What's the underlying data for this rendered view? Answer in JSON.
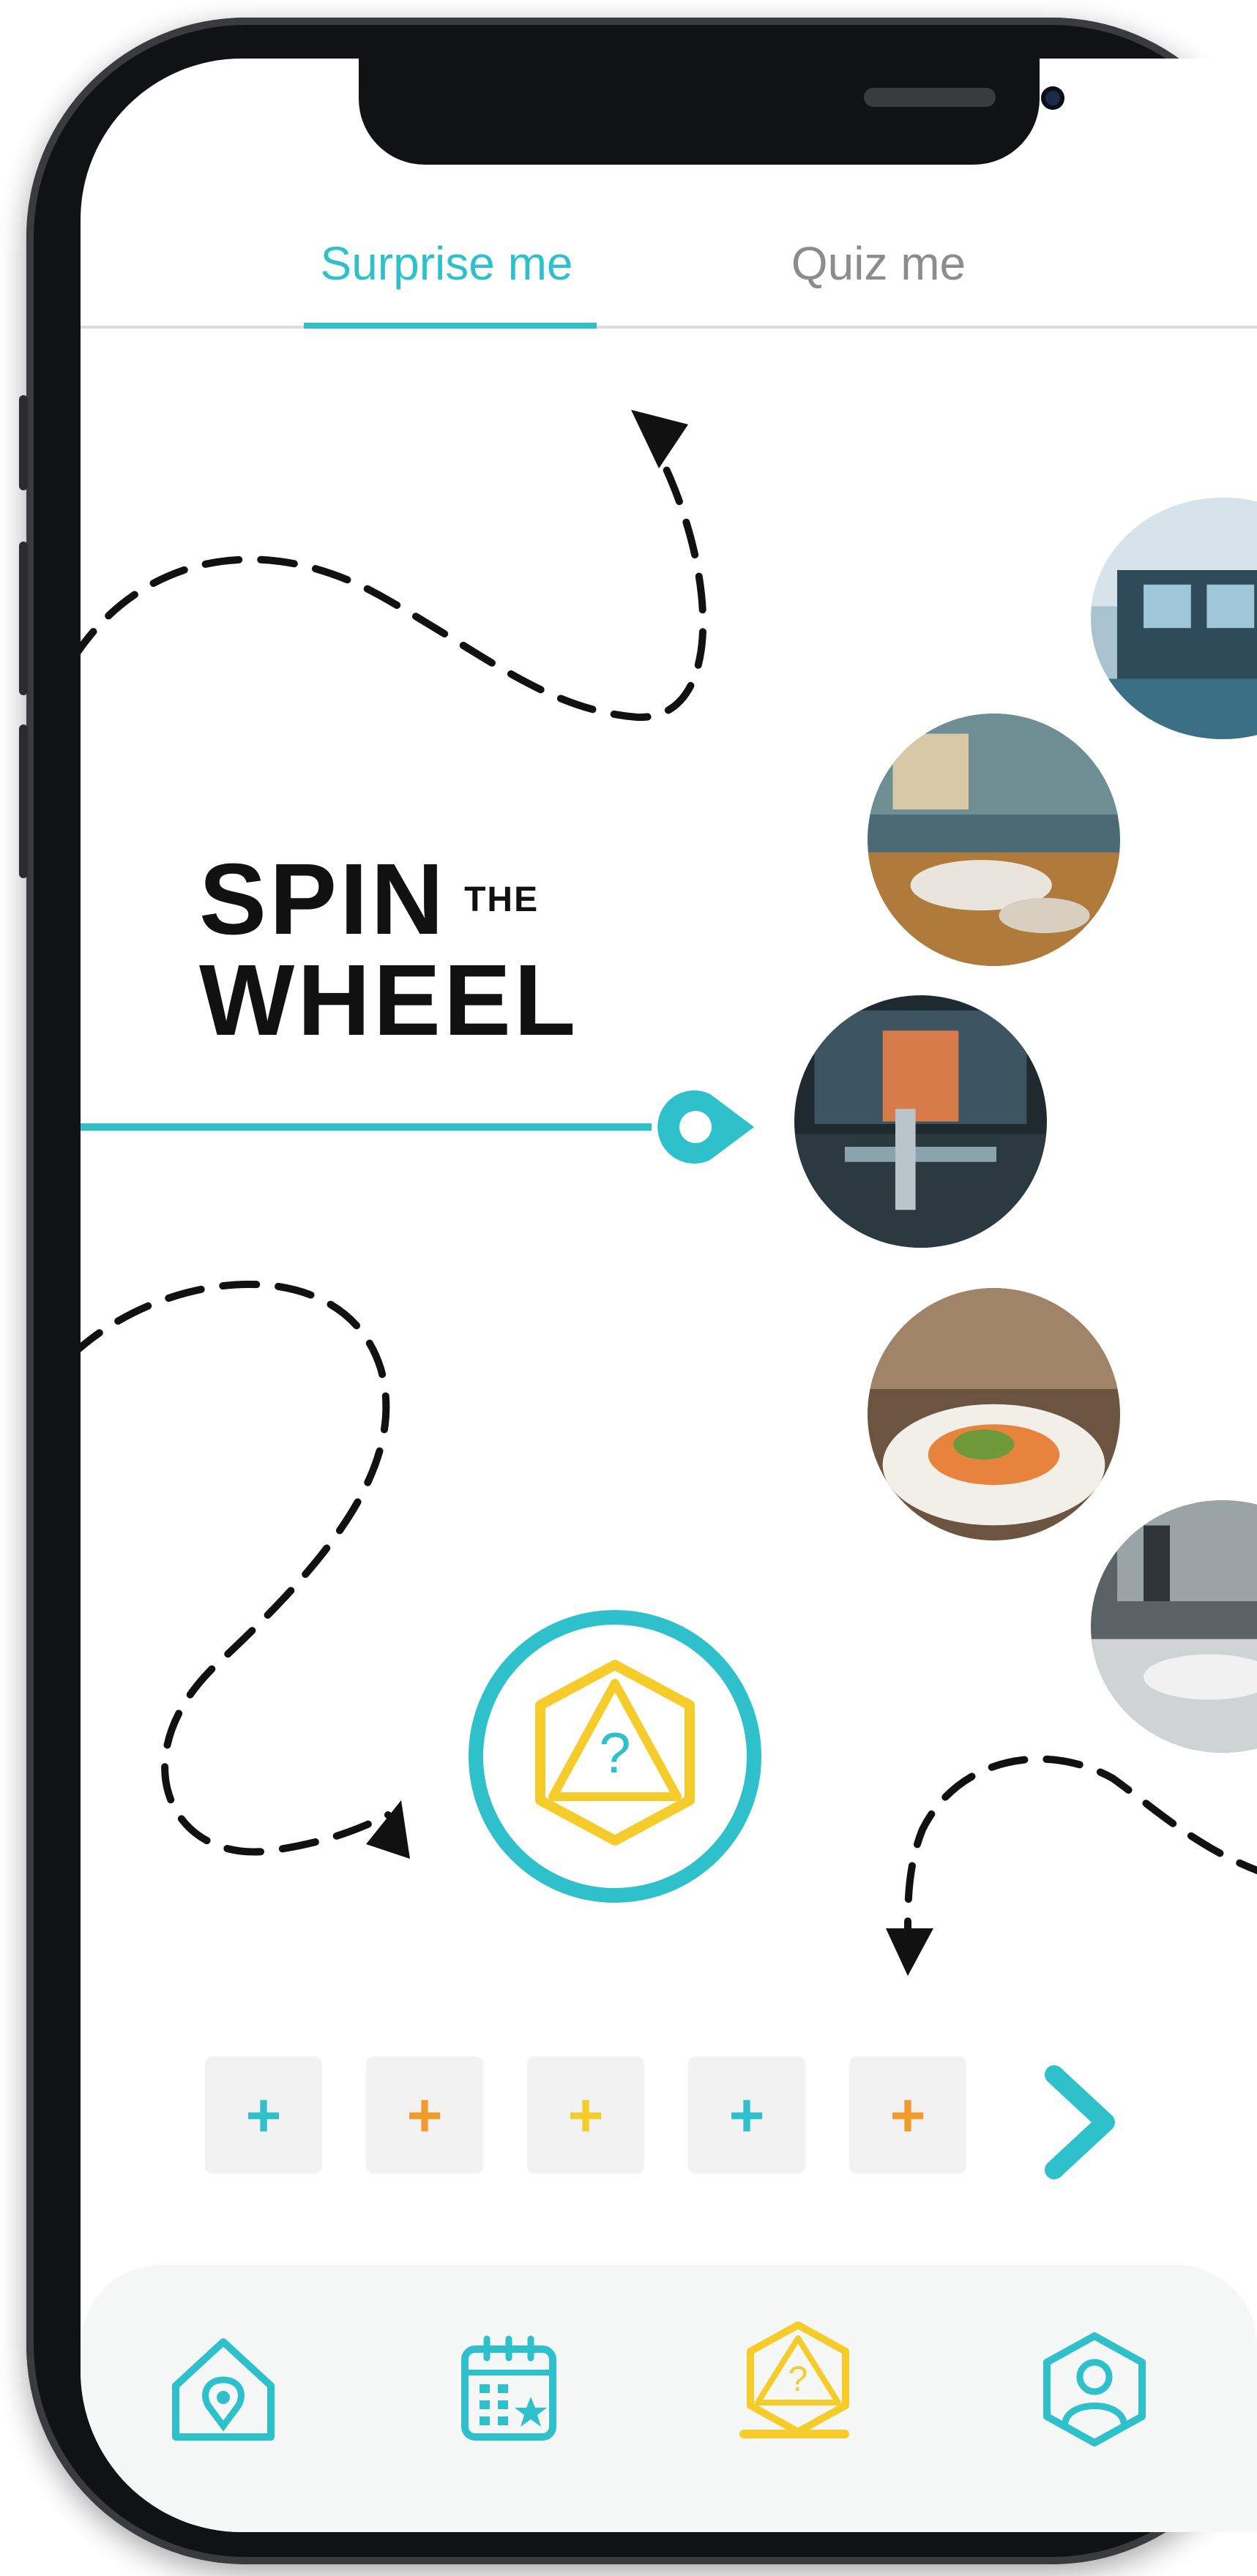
{
  "tabs": [
    {
      "label": "Surprise me",
      "active": true
    },
    {
      "label": "Quiz me",
      "active": false
    }
  ],
  "hero": {
    "title_line1": "SPIN",
    "title_small": "THE",
    "title_line2": "WHEEL"
  },
  "spin_button": {
    "icon": "dice-question-icon",
    "glyph": "?"
  },
  "restaurant_photos": [
    {
      "name": "restaurant-photo-1",
      "theme": "waterfront"
    },
    {
      "name": "restaurant-photo-2",
      "theme": "dining-table"
    },
    {
      "name": "restaurant-photo-3",
      "theme": "bar-interior"
    },
    {
      "name": "restaurant-photo-4",
      "theme": "plated-dish"
    },
    {
      "name": "restaurant-photo-5",
      "theme": "dining-room"
    }
  ],
  "add_buttons": [
    {
      "label": "+",
      "color": "#2fc1cb"
    },
    {
      "label": "+",
      "color": "#f39a2c"
    },
    {
      "label": "+",
      "color": "#f6cc2a"
    },
    {
      "label": "+",
      "color": "#2fc1cb"
    },
    {
      "label": "+",
      "color": "#f39a2c"
    }
  ],
  "bottom_nav": [
    {
      "name": "home",
      "icon": "home-location-icon",
      "active": false
    },
    {
      "name": "calendar",
      "icon": "calendar-icon",
      "active": false
    },
    {
      "name": "spin",
      "icon": "dice-question-icon",
      "active": true
    },
    {
      "name": "profile",
      "icon": "profile-icon",
      "active": false
    }
  ],
  "colors": {
    "accent": "#2fc1cb",
    "yellow": "#f6cc2a",
    "orange": "#f39a2c",
    "text_dark": "#111111",
    "tab_inactive": "#8c8c8c"
  }
}
